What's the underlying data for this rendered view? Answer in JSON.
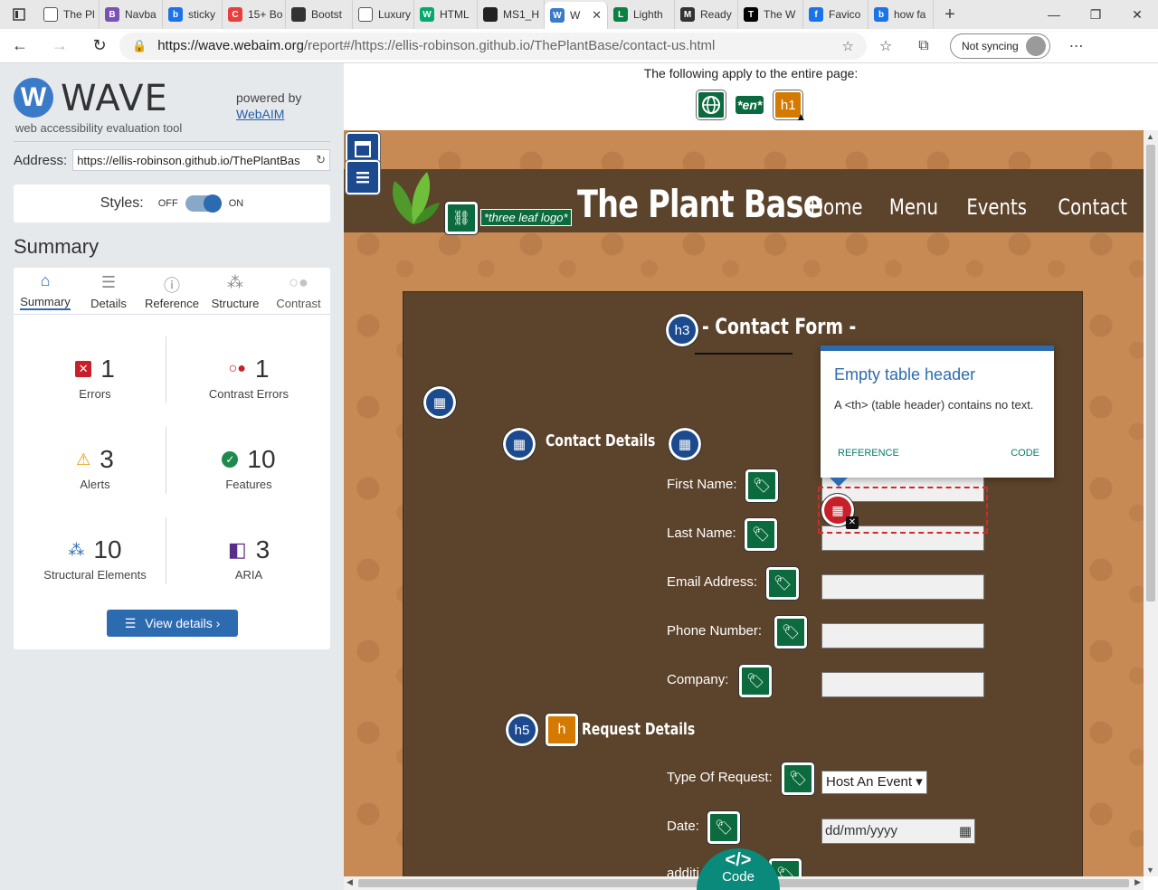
{
  "browser": {
    "tabs": [
      {
        "label": "The Pl",
        "fav": "doc-icon",
        "color": "#ffffff"
      },
      {
        "label": "Navba",
        "fav": "B",
        "color": "#7952b3"
      },
      {
        "label": "sticky",
        "fav": "b",
        "color": "#1a73e8"
      },
      {
        "label": "15+ Bo",
        "fav": "C",
        "color": "#e83e3e"
      },
      {
        "label": "Bootst",
        "fav": "gear",
        "color": "#333333"
      },
      {
        "label": "Luxury",
        "fav": "doc-icon",
        "color": "#ffffff"
      },
      {
        "label": "HTML",
        "fav": "W",
        "color": "#04aa6d"
      },
      {
        "label": "MS1_H",
        "fav": "github",
        "color": "#222222"
      },
      {
        "label": "W",
        "fav": "W",
        "color": "#3a7bc8"
      },
      {
        "label": "Lighth",
        "fav": "L",
        "color": "#0b8043"
      },
      {
        "label": "Ready",
        "fav": "M",
        "color": "#333333"
      },
      {
        "label": "The W",
        "fav": "T",
        "color": "#000000"
      },
      {
        "label": "Favico",
        "fav": "f",
        "color": "#1a73e8"
      },
      {
        "label": "how fa",
        "fav": "b",
        "color": "#1a73e8"
      }
    ],
    "url_host": "https://wave.webaim.org",
    "url_path": "/report#/https://ellis-robinson.github.io/ThePlantBase/contact-us.html",
    "sync_label": "Not syncing"
  },
  "wave": {
    "logo_word": "WAVE",
    "tagline": "web accessibility evaluation tool",
    "powered_by": "powered by",
    "webaim_link": "WebAIM",
    "address_label": "Address:",
    "address_value": "https://ellis-robinson.github.io/ThePlantBas",
    "styles_label": "Styles:",
    "styles_off": "OFF",
    "styles_on": "ON",
    "summary_title": "Summary",
    "tabs": [
      "Summary",
      "Details",
      "Reference",
      "Structure",
      "Contrast"
    ],
    "stats": {
      "errors": {
        "count": "1",
        "label": "Errors"
      },
      "contrast": {
        "count": "1",
        "label": "Contrast Errors"
      },
      "alerts": {
        "count": "3",
        "label": "Alerts"
      },
      "features": {
        "count": "10",
        "label": "Features"
      },
      "structural": {
        "count": "10",
        "label": "Structural Elements"
      },
      "aria": {
        "count": "3",
        "label": "ARIA"
      }
    },
    "view_details": "View details ›"
  },
  "report": {
    "applies_text": "The following apply to the entire page:",
    "lang_tag": "*en*",
    "h1_tag": "h1"
  },
  "site": {
    "brand": "The Plant Base",
    "logo_alt": "*three leaf logo*",
    "nav": [
      "Home",
      "Menu",
      "Events",
      "Contact"
    ],
    "form_title": "- Contact Form -",
    "h3_tag": "h3",
    "h5_tag": "h5",
    "contact_details": "Contact Details",
    "request_details": "Request Details",
    "fields": [
      "First Name:",
      "Last Name:",
      "Email Address:",
      "Phone Number:",
      "Company:"
    ],
    "type_label": "Type Of Request:",
    "type_value": "Host An Event",
    "date_label": "Date:",
    "date_placeholder": "dd/mm/yyyy",
    "partial_label": "additi"
  },
  "popup": {
    "title": "Empty table header",
    "desc": "A <th> (table header) contains no text.",
    "reference": "REFERENCE",
    "code": "CODE"
  },
  "code_button": "Code"
}
